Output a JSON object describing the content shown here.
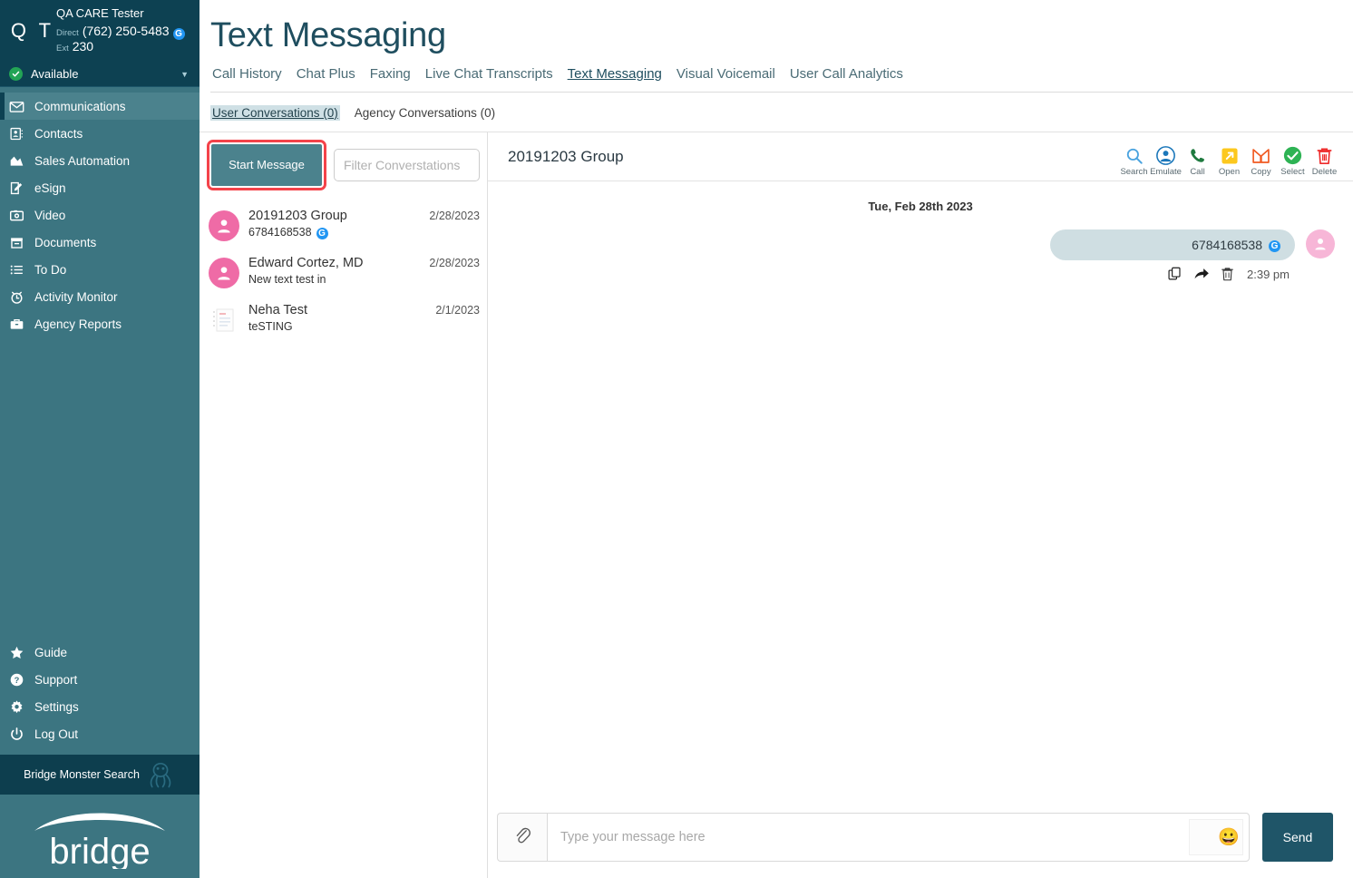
{
  "sidebar": {
    "profile": {
      "initials": "Q T",
      "name": "QA CARE Tester",
      "direct_label": "Direct",
      "direct_number": "(762) 250-5483",
      "ext_label": "Ext",
      "ext_number": "230",
      "badge_icon": "google-badge-icon"
    },
    "status": {
      "label": "Available",
      "color": "#23a455",
      "caret_icon": "chevron-down-icon"
    },
    "items": [
      {
        "label": "Communications",
        "icon": "envelope-icon",
        "active": true
      },
      {
        "label": "Contacts",
        "icon": "contact-card-icon",
        "active": false
      },
      {
        "label": "Sales Automation",
        "icon": "chart-area-icon",
        "active": false
      },
      {
        "label": "eSign",
        "icon": "pencil-document-icon",
        "active": false
      },
      {
        "label": "Video",
        "icon": "camera-icon",
        "active": false
      },
      {
        "label": "Documents",
        "icon": "archive-box-icon",
        "active": false
      },
      {
        "label": "To Do",
        "icon": "list-icon",
        "active": false
      },
      {
        "label": "Activity Monitor",
        "icon": "stopwatch-icon",
        "active": false
      },
      {
        "label": "Agency Reports",
        "icon": "briefcase-icon",
        "active": false
      }
    ],
    "bottom_items": [
      {
        "label": "Guide",
        "icon": "star-icon"
      },
      {
        "label": "Support",
        "icon": "question-circle-icon"
      },
      {
        "label": "Settings",
        "icon": "gear-icon"
      },
      {
        "label": "Log Out",
        "icon": "power-icon"
      }
    ],
    "monster_search": {
      "label": "Bridge Monster Search",
      "icon": "octopus-icon"
    },
    "brand": {
      "name": "bridge"
    },
    "bg_color": "#3c7581",
    "dark_color": "#0d4152"
  },
  "header": {
    "title": "Text Messaging",
    "tabs": [
      {
        "label": "Call History",
        "active": false
      },
      {
        "label": "Chat Plus",
        "active": false
      },
      {
        "label": "Faxing",
        "active": false
      },
      {
        "label": "Live Chat Transcripts",
        "active": false
      },
      {
        "label": "Text Messaging",
        "active": true
      },
      {
        "label": "Visual Voicemail",
        "active": false
      },
      {
        "label": "User Call Analytics",
        "active": false
      }
    ],
    "subtabs": [
      {
        "label": "User Conversations (0)",
        "active": true
      },
      {
        "label": "Agency Conversations (0)",
        "active": false
      }
    ]
  },
  "conversations_panel": {
    "start_button": "Start Message",
    "filter_placeholder": "Filter Converstations",
    "items": [
      {
        "name": "20191203 Group",
        "date": "2/28/2023",
        "snippet": "6784168538",
        "snippet_badge_icon": "google-badge-icon",
        "avatar": "person-avatar",
        "avatar_color": "#ef6ba6"
      },
      {
        "name": "Edward Cortez, MD",
        "date": "2/28/2023",
        "snippet": "New text test in",
        "snippet_badge_icon": "",
        "avatar": "person-avatar",
        "avatar_color": "#ef6ba6"
      },
      {
        "name": "Neha Test",
        "date": "2/1/2023",
        "snippet": "teSTING",
        "snippet_badge_icon": "",
        "avatar": "broken-image-placeholder",
        "avatar_color": "transparent"
      }
    ]
  },
  "thread": {
    "title": "20191203 Group",
    "tools": [
      {
        "label": "Search",
        "icon": "search-icon",
        "color": "#4aa3df"
      },
      {
        "label": "Emulate",
        "icon": "user-circle-icon",
        "color": "#1b77ba"
      },
      {
        "label": "Call",
        "icon": "phone-icon",
        "color": "#1f7a3f"
      },
      {
        "label": "Open",
        "icon": "open-external-icon",
        "color": "#f7c02a"
      },
      {
        "label": "Copy",
        "icon": "copy-crossed-icon",
        "color": "#f05a22"
      },
      {
        "label": "Select",
        "icon": "check-circle-icon",
        "color": "#2eb354"
      },
      {
        "label": "Delete",
        "icon": "trash-icon",
        "color": "#ee2b2b"
      }
    ],
    "day_separator": "Tue, Feb 28th 2023",
    "messages": [
      {
        "text": "6784168538",
        "badge_icon": "google-badge-icon",
        "time": "2:39 pm",
        "direction": "outgoing",
        "actions": [
          {
            "icon": "copy-icon",
            "label": "Copy"
          },
          {
            "icon": "forward-icon",
            "label": "Forward"
          },
          {
            "icon": "trash-icon",
            "label": "Delete"
          }
        ],
        "avatar": "person-avatar",
        "avatar_color": "#f7b6d7",
        "bubble_color": "#cfdee2"
      }
    ]
  },
  "composer": {
    "attach_icon": "paperclip-icon",
    "placeholder": "Type your message here",
    "value": "",
    "emoji_icon": "grinning-face-emoji",
    "send_label": "Send"
  }
}
